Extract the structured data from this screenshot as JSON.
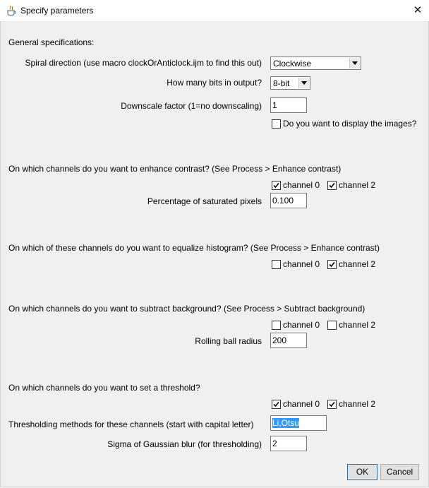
{
  "window": {
    "title": "Specify parameters",
    "icon": "java-cup-icon",
    "close_glyph": "✕"
  },
  "general": {
    "heading": "General specifications:",
    "spiral_label": "Spiral direction (use macro clockOrAnticlock.ijm to find this out)",
    "spiral_value": "Clockwise",
    "bits_label": "How many bits in output?",
    "bits_value": "8-bit",
    "downscale_label": "Downscale factor (1=no downscaling)",
    "downscale_value": "1",
    "display_label": "Do you want to display the images?",
    "display_checked": false
  },
  "contrast": {
    "heading": "On which channels do you want to enhance contrast? (See Process > Enhance contrast)",
    "ch0_label": "channel 0",
    "ch0_checked": true,
    "ch2_label": "channel 2",
    "ch2_checked": true,
    "saturated_label": "Percentage of saturated pixels",
    "saturated_value": "0.100"
  },
  "equalize": {
    "heading": "On which of these channels do you want to equalize histogram? (See Process > Enhance contrast)",
    "ch0_label": "channel 0",
    "ch0_checked": false,
    "ch2_label": "channel 2",
    "ch2_checked": true
  },
  "background": {
    "heading": "On which channels do you want to subtract background? (See Process > Subtract background)",
    "ch0_label": "channel 0",
    "ch0_checked": false,
    "ch2_label": "channel 2",
    "ch2_checked": false,
    "radius_label": "Rolling ball radius",
    "radius_value": "200"
  },
  "threshold": {
    "heading": "On which channels do you want to set a threshold?",
    "ch0_label": "channel 0",
    "ch0_checked": true,
    "ch2_label": "channel 2",
    "ch2_checked": true,
    "methods_label": "Thresholding methods for these channels (start with capital letter)",
    "methods_value": "Li,Otsu",
    "sigma_label": "Sigma of Gaussian blur (for thresholding)",
    "sigma_value": "2"
  },
  "buttons": {
    "ok": "OK",
    "cancel": "Cancel"
  },
  "colors": {
    "selection": "#3399ff",
    "default_button_border": "#0078d7",
    "dialog_bg": "#f0f0f0"
  }
}
